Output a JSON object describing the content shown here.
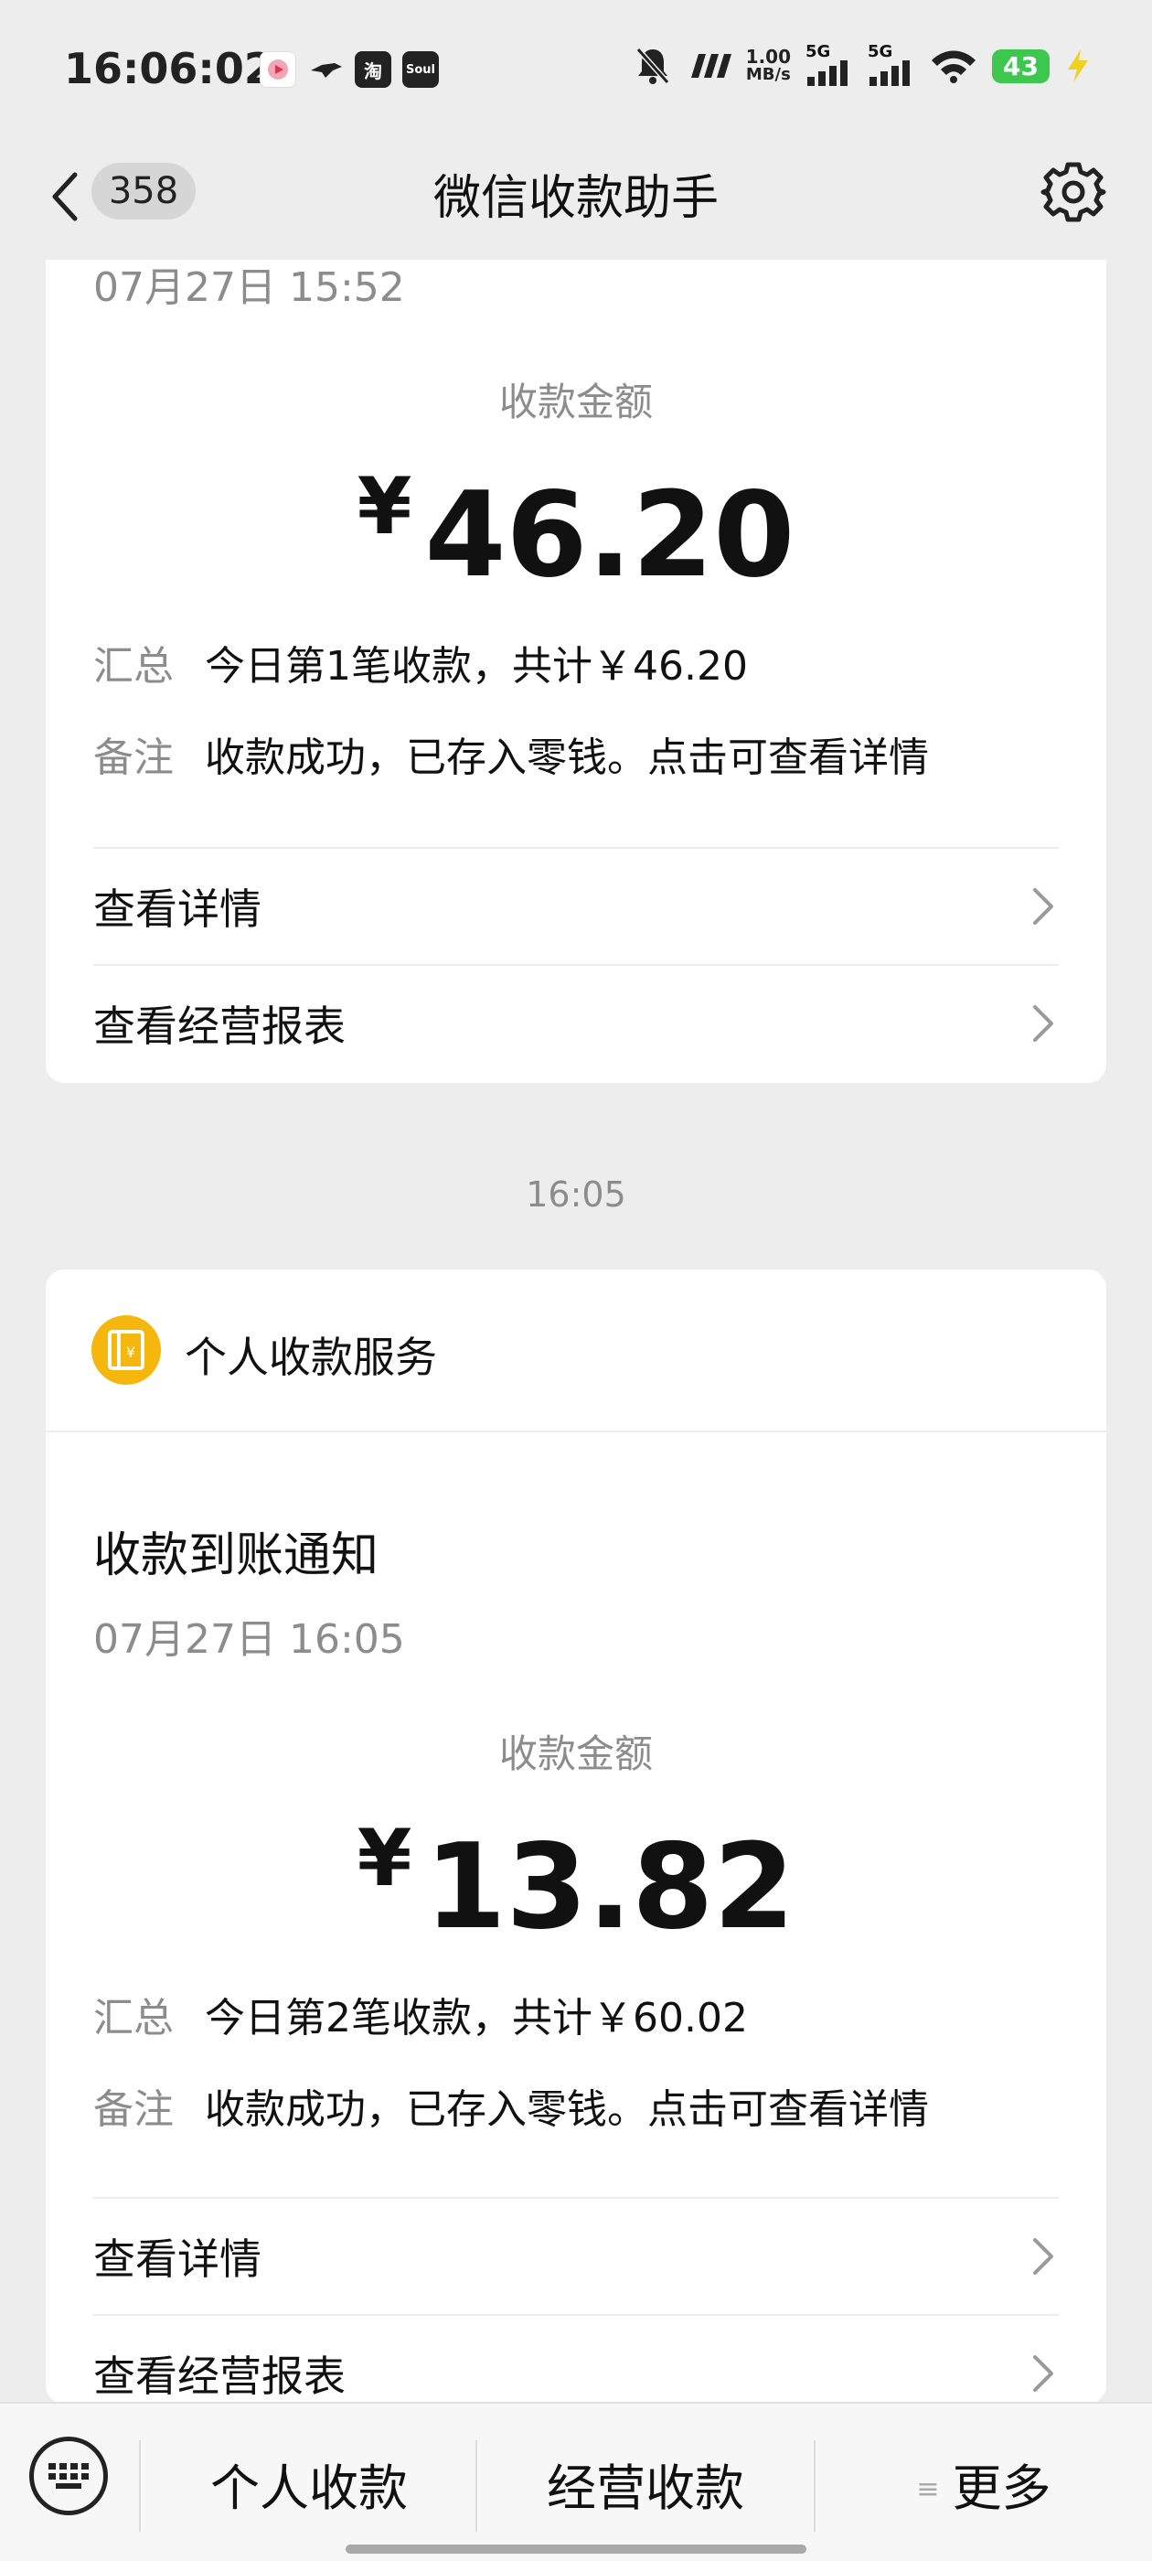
{
  "status_bar": {
    "time": "16:06:02",
    "apps": [
      {
        "icon": "video-app-icon",
        "text": "",
        "color": "#ffffff"
      },
      {
        "icon": "bird-app-icon",
        "text": "",
        "color": "#ededed"
      },
      {
        "icon": "taobao-app-icon",
        "text": "淘",
        "color": "#222222"
      },
      {
        "icon": "soul-app-icon",
        "text": "Soul",
        "color": "#222222"
      }
    ],
    "net_speed_value": "1.00",
    "net_speed_unit": "MB/s",
    "signal_1": "5G",
    "signal_2": "5G",
    "battery": "43"
  },
  "nav": {
    "unread_count": "358",
    "title": "微信收款助手"
  },
  "card_top": {
    "date": "07月27日 15:52",
    "amount_label": "收款金额",
    "currency": "¥",
    "amount": "46.20",
    "summary_key": "汇总",
    "summary_value": "今日第1笔收款，共计￥46.20",
    "remark_key": "备注",
    "remark_value": "收款成功，已存入零钱。点击可查看详情",
    "link_details": "查看详情",
    "link_report": "查看经营报表"
  },
  "time_separator": "16:05",
  "card_bottom": {
    "service_name": "个人收款服务",
    "notice_title": "收款到账通知",
    "date": "07月27日 16:05",
    "amount_label": "收款金额",
    "currency": "¥",
    "amount": "13.82",
    "summary_key": "汇总",
    "summary_value": "今日第2笔收款，共计￥60.02",
    "remark_key": "备注",
    "remark_value": "收款成功，已存入零钱。点击可查看详情",
    "link_details": "查看详情",
    "link_report": "查看经营报表"
  },
  "bottom_menu": {
    "item_1": "个人收款",
    "item_2": "经营收款",
    "item_3_icon": "≡",
    "item_3": "更多"
  },
  "colors": {
    "background": "#ededed",
    "card": "#ffffff",
    "accent_yellow": "#f5b60d",
    "battery_green": "#3dc74e",
    "muted_text": "#8c8c8c"
  }
}
